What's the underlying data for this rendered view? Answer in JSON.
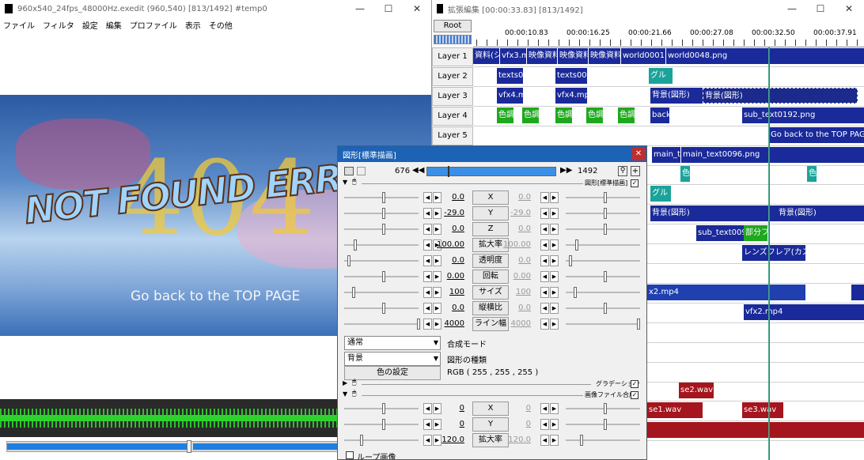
{
  "main": {
    "title": "960x540_24fps_48000Hz.exedit (960,540)  [813/1492]  #temp0",
    "menu": [
      "ファイル",
      "フィルタ",
      "設定",
      "編集",
      "プロファイル",
      "表示",
      "その他"
    ],
    "preview_text": "NOT FOUND ERROR",
    "preview_404": "404",
    "preview_goback": "Go back to the TOP PAGE",
    "seek_position": 0.43
  },
  "timeline": {
    "title": "拡張編集 [00:00:33.83] [813/1492]",
    "root_label": "Root",
    "ruler": [
      "00:00:10.83",
      "00:00:16.25",
      "00:00:21.66",
      "00:00:27.08",
      "00:00:32.50",
      "00:00:37.91"
    ],
    "layers": [
      "Layer 1",
      "Layer 2",
      "Layer 3",
      "Layer 4",
      "Layer 5"
    ],
    "clips": {
      "l1": [
        "資料(シ",
        "vfx3.m",
        "映像資料",
        "映像資料",
        "映像資料",
        "world0001.pn",
        "world0048.png"
      ],
      "l2": [
        "texts00",
        "texts009",
        "グル"
      ],
      "l3": [
        "vfx4.m",
        "vfx4.mp4",
        "背景(図形)",
        "背景(図形)"
      ],
      "l4": [
        "色調",
        "色調",
        "色調",
        "色調",
        "色調",
        "back",
        "sub_text0192.png"
      ],
      "l5": [
        "Go back to the TOP PAGE"
      ],
      "l6": [
        "main_te",
        "main_text0096.png"
      ],
      "l7": [
        "色",
        "色"
      ],
      "l8": [
        "グル"
      ],
      "l9": [
        "背景(図形)",
        "背景(図形)"
      ],
      "l10": [
        "sub_text0096",
        "部分フィ"
      ],
      "l11": [
        "レンズフレア(カスタム"
      ],
      "l13": [
        "x2.mp4"
      ],
      "l14": [
        "vfx2.mp4"
      ],
      "l17": [
        "se2.wav"
      ],
      "l18": [
        "se1.wav",
        "se3.wav"
      ]
    }
  },
  "dialog": {
    "title": "図形[標準描画]",
    "frame_start": "676",
    "frame_end": "1492",
    "section1": "図形[標準描画]",
    "params": [
      {
        "label": "X",
        "v1": "0.0",
        "v2": "0.0"
      },
      {
        "label": "Y",
        "v1": "-29.0",
        "v2": "-29.0"
      },
      {
        "label": "Z",
        "v1": "0.0",
        "v2": "0.0"
      },
      {
        "label": "拡大率",
        "v1": "100.00",
        "v2": "100.00"
      },
      {
        "label": "透明度",
        "v1": "0.0",
        "v2": "0.0"
      },
      {
        "label": "回転",
        "v1": "0.00",
        "v2": "0.00"
      },
      {
        "label": "サイズ",
        "v1": "100",
        "v2": "100"
      },
      {
        "label": "縦横比",
        "v1": "0.0",
        "v2": "0.0"
      },
      {
        "label": "ライン幅",
        "v1": "4000",
        "v2": "4000"
      }
    ],
    "blend_value": "通常",
    "blend_label": "合成モード",
    "shape_value": "背景",
    "shape_label": "図形の種類",
    "color_button": "色の設定",
    "rgb": "RGB ( 255 , 255 , 255 )",
    "section2": "グラデーション",
    "section3": "画像ファイル合成",
    "params2": [
      {
        "label": "X",
        "v1": "0",
        "v2": "0"
      },
      {
        "label": "Y",
        "v1": "0",
        "v2": "0"
      },
      {
        "label": "拡大率",
        "v1": "120.0",
        "v2": "120.0"
      }
    ],
    "loop_label": "ループ画像"
  }
}
